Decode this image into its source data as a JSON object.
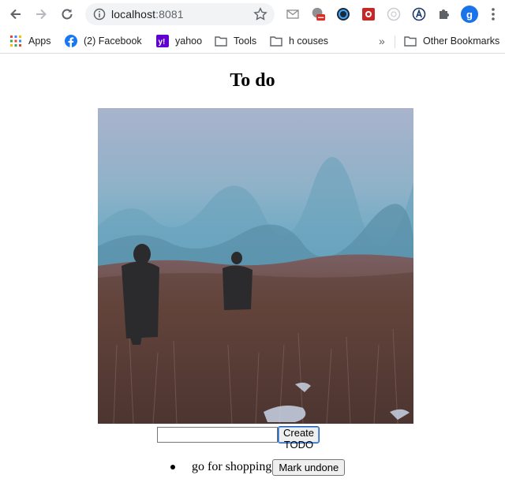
{
  "browser": {
    "url_host": "localhost",
    "url_port": ":8081",
    "profile_initial": "g",
    "bookmarks": [
      {
        "label": "Apps",
        "icon": "apps-grid-icon"
      },
      {
        "label": "(2) Facebook",
        "icon": "facebook-icon"
      },
      {
        "label": "yahoo",
        "icon": "yahoo-icon"
      },
      {
        "label": "Tools",
        "icon": "folder-icon"
      },
      {
        "label": "h couses",
        "icon": "folder-icon"
      }
    ],
    "overflow_label": "»",
    "other_bookmarks": "Other Bookmarks",
    "extensions": [
      "mail-icon",
      "extension-badge-icon",
      "clock-icon",
      "red-extension-icon",
      "circle-extension-icon",
      "a-extension-icon",
      "puzzle-icon"
    ]
  },
  "page": {
    "title": "To do",
    "photo": "misty-field-photo",
    "input_value": "",
    "create_button_label": "Create TODO",
    "todos": [
      {
        "text": "go for shopping",
        "button_label": "Mark undone"
      }
    ]
  },
  "colors": {
    "omnibox_bg": "#f1f3f4",
    "profile": "#1a73e8",
    "focus_ring": "#1a5fb4"
  }
}
